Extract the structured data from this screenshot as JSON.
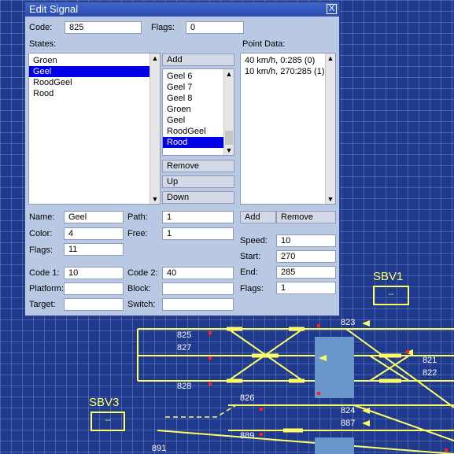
{
  "dialog": {
    "title": "Edit Signal",
    "close_glyph": "X",
    "code_label": "Code:",
    "code_value": "825",
    "flags_label": "Flags:",
    "flags_value": "0",
    "states_label": "States:",
    "states": [
      {
        "label": "Groen",
        "selected": false
      },
      {
        "label": "Geel",
        "selected": true
      },
      {
        "label": "RoodGeel",
        "selected": false
      },
      {
        "label": "Rood",
        "selected": false
      }
    ],
    "add_label": "Add",
    "aspects": [
      {
        "label": "Geel 6",
        "selected": false
      },
      {
        "label": "Geel 7",
        "selected": false
      },
      {
        "label": "Geel 8",
        "selected": false
      },
      {
        "label": "Groen",
        "selected": false
      },
      {
        "label": "Geel",
        "selected": false
      },
      {
        "label": "RoodGeel",
        "selected": false
      },
      {
        "label": "Rood",
        "selected": true
      }
    ],
    "remove_label": "Remove",
    "up_label": "Up",
    "down_label": "Down",
    "point_data_label": "Point Data:",
    "point_data": [
      {
        "label": "40 km/h, 0:285 (0)"
      },
      {
        "label": "10 km/h, 270:285 (1)"
      }
    ],
    "pd_add_label": "Add",
    "pd_remove_label": "Remove",
    "name_label": "Name:",
    "name_value": "Geel",
    "path_label": "Path:",
    "path_value": "1",
    "color_label": "Color:",
    "color_value": "4",
    "free_label": "Free:",
    "free_value": "1",
    "state_flags_label": "Flags:",
    "state_flags_value": "11",
    "speed_label": "Speed:",
    "speed_value": "10",
    "start_label": "Start:",
    "start_value": "270",
    "end_label": "End:",
    "end_value": "285",
    "pd_flags_label": "Flags:",
    "pd_flags_value": "1",
    "code1_label": "Code 1:",
    "code1_value": "10",
    "code2_label": "Code 2:",
    "code2_value": "40",
    "platform_label": "Platform:",
    "platform_value": "",
    "block_label": "Block:",
    "block_value": "",
    "target_label": "Target:",
    "target_value": "",
    "switch_label": "Switch:",
    "switch_value": ""
  },
  "track": {
    "labels": {
      "l825": "825",
      "l827": "827",
      "l828": "828",
      "l823": "823",
      "l821": "821",
      "l822": "822",
      "l826": "826",
      "l824": "824",
      "l887": "887",
      "l889": "889",
      "l891": "891"
    },
    "signals": {
      "sbv1_name": "SBV1",
      "sbv1_value": "--",
      "sbv3_name": "SBV3",
      "sbv3_value": "--"
    },
    "colors": {
      "background": "#1f3a8c",
      "track": "#ffff66",
      "platform": "#6b96c9",
      "marker": "#ff2020"
    }
  }
}
